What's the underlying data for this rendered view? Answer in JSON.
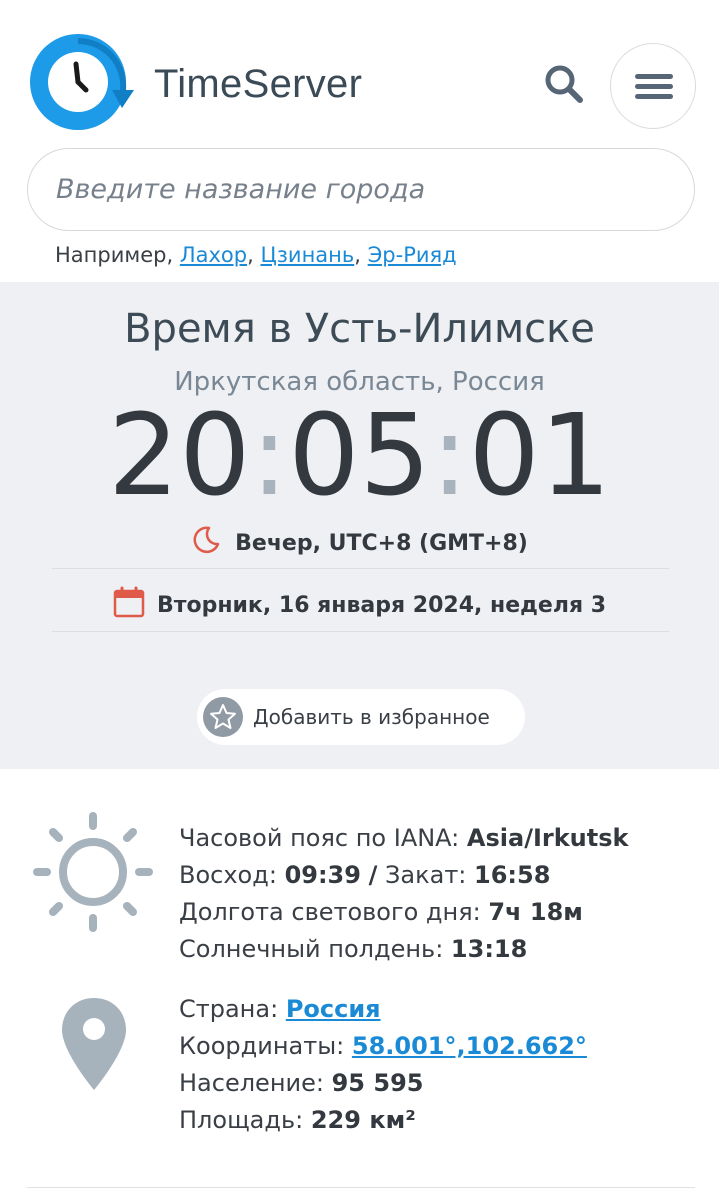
{
  "header": {
    "brand": "TimeServer",
    "logo_icon": "clock-logo-icon",
    "search_icon": "search-icon",
    "menu_icon": "hamburger-menu-icon"
  },
  "search": {
    "placeholder": "Введите название города",
    "value": ""
  },
  "examples": {
    "prefix": "Например,",
    "cities": [
      "Лахор",
      "Цзинань",
      "Эр-Рияд"
    ]
  },
  "city": {
    "title": "Время в Усть-Илимске",
    "region": "Иркутская область, Россия"
  },
  "clock": {
    "hours": "20",
    "minutes": "05",
    "seconds": "01"
  },
  "time_of_day": {
    "icon": "moon-icon",
    "text": "Вечер, UTC+8 (GMT+8)"
  },
  "date": {
    "icon": "calendar-icon",
    "text": "Вторник, 16 января 2024, неделя 3"
  },
  "favorites": {
    "icon": "star-icon",
    "label": "Добавить в избранное"
  },
  "sun_info": {
    "icon": "sun-icon",
    "timezone_label": "Часовой пояс по IANA:",
    "timezone_value": "Asia/Irkutsk",
    "sunrise_label": "Восход:",
    "sunrise_value": "09:39",
    "sep": "/",
    "sunset_label": "Закат:",
    "sunset_value": "16:58",
    "daylength_label": "Долгота светового дня:",
    "daylength_value": "7ч 18м",
    "noon_label": "Солнечный полдень:",
    "noon_value": "13:18"
  },
  "place_info": {
    "icon": "location-pin-icon",
    "country_label": "Страна:",
    "country_value": "Россия",
    "coords_label": "Координаты:",
    "coords_value": "58.001°,102.662°",
    "population_label": "Население:",
    "population_value": "95 595",
    "area_label": "Площадь:",
    "area_value": "229 км²"
  },
  "colors": {
    "accent_link": "#1a8ad6",
    "logo_blue": "#1d9be8",
    "icon_red": "#e05a4a",
    "icon_grey": "#a6b2bc",
    "panel_bg": "#eef0f3"
  }
}
